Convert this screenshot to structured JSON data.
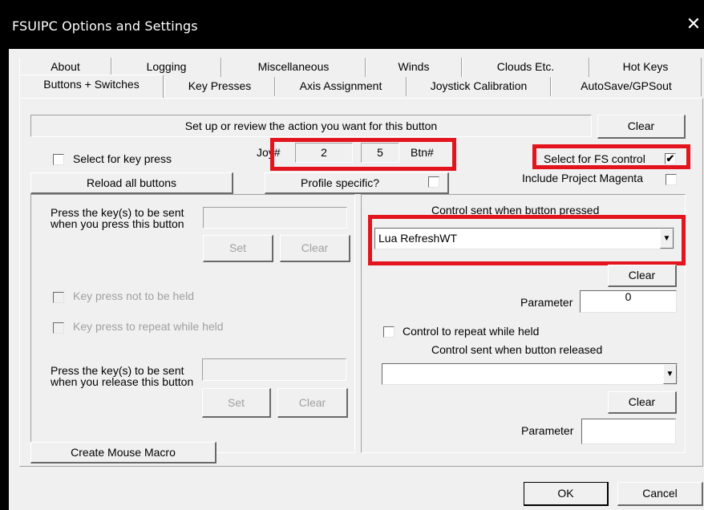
{
  "window": {
    "title": "FSUIPC Options and Settings",
    "close_glyph": "✕"
  },
  "tabs_row1": [
    "About",
    "Logging",
    "Miscellaneous",
    "Winds",
    "Clouds Etc.",
    "Hot Keys"
  ],
  "tabs_row2": [
    "Buttons + Switches",
    "Key Presses",
    "Axis Assignment",
    "Joystick Calibration",
    "AutoSave/GPSout"
  ],
  "top": {
    "prompt": "Set up or review the action you want for this button",
    "clear_label": "Clear",
    "select_key_press": "Select for key press",
    "joy_label": "Joy#",
    "joy_value": "2",
    "btn_value": "5",
    "btn_label": "Btn#",
    "select_fs_control": "Select for FS control",
    "select_fs_control_checked": true,
    "reload_all_buttons": "Reload all buttons",
    "profile_specific": "Profile specific?",
    "include_project_magenta": "Include Project Magenta"
  },
  "left": {
    "press_keys_label": "Press the key(s) to be sent when you press this button",
    "set_label": "Set",
    "clear_label": "Clear",
    "not_held_label": "Key press not to be held",
    "repeat_label": "Key press to repeat while held",
    "release_keys_label": "Press the key(s) to be sent when you release this button",
    "set2_label": "Set",
    "clear2_label": "Clear",
    "mouse_macro": "Create Mouse Macro"
  },
  "right": {
    "pressed_label": "Control sent when button pressed",
    "pressed_value": "Lua RefreshWT",
    "clear_label": "Clear",
    "parameter_label": "Parameter",
    "parameter_value": "0",
    "repeat_label": "Control to repeat while held",
    "released_label": "Control sent when button released",
    "released_value": "",
    "clear2_label": "Clear",
    "parameter2_label": "Parameter",
    "parameter2_value": ""
  },
  "footer": {
    "ok": "OK",
    "cancel": "Cancel"
  },
  "colors": {
    "highlight": "#e3141d",
    "dialog_bg": "#f0f0f0",
    "titlebar": "#000000"
  }
}
